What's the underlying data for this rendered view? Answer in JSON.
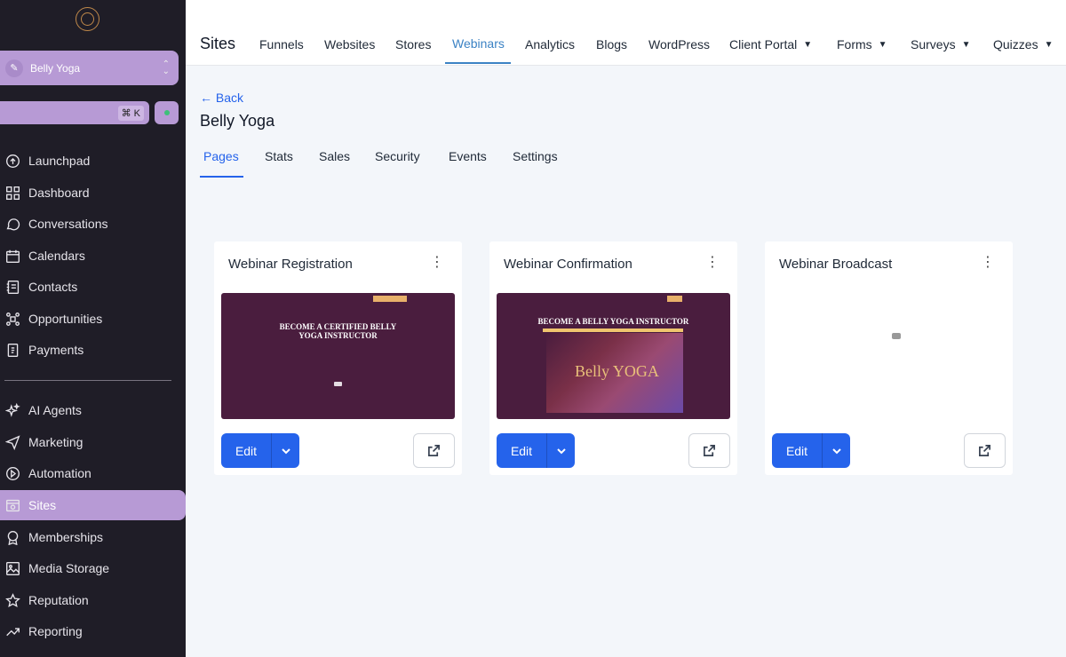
{
  "account": {
    "name": "Belly Yoga"
  },
  "search": {
    "shortcut": "⌘ K"
  },
  "sidebar": {
    "items": [
      {
        "label": "Launchpad",
        "icon": "launchpad-icon"
      },
      {
        "label": "Dashboard",
        "icon": "dashboard-icon"
      },
      {
        "label": "Conversations",
        "icon": "chat-icon"
      },
      {
        "label": "Calendars",
        "icon": "calendar-icon"
      },
      {
        "label": "Contacts",
        "icon": "contacts-icon"
      },
      {
        "label": "Opportunities",
        "icon": "opportunities-icon"
      },
      {
        "label": "Payments",
        "icon": "payments-icon"
      },
      {
        "label": "AI Agents",
        "icon": "sparkle-icon"
      },
      {
        "label": "Marketing",
        "icon": "send-icon"
      },
      {
        "label": "Automation",
        "icon": "automation-icon"
      },
      {
        "label": "Sites",
        "icon": "sites-icon"
      },
      {
        "label": "Memberships",
        "icon": "membership-icon"
      },
      {
        "label": "Media Storage",
        "icon": "image-icon"
      },
      {
        "label": "Reputation",
        "icon": "star-icon"
      },
      {
        "label": "Reporting",
        "icon": "trend-icon"
      }
    ],
    "active": "Sites"
  },
  "topbar": {
    "title": "Sites",
    "tabs": [
      {
        "label": "Funnels"
      },
      {
        "label": "Websites"
      },
      {
        "label": "Stores"
      },
      {
        "label": "Webinars"
      },
      {
        "label": "Analytics"
      },
      {
        "label": "Blogs"
      },
      {
        "label": "WordPress"
      },
      {
        "label": "Client Portal"
      },
      {
        "label": "Forms"
      },
      {
        "label": "Surveys"
      },
      {
        "label": "Quizzes"
      }
    ],
    "active": "Webinars"
  },
  "page": {
    "back": "← Back",
    "title": "Belly Yoga",
    "subtabs": [
      {
        "label": "Pages"
      },
      {
        "label": "Stats"
      },
      {
        "label": "Sales"
      },
      {
        "label": "Security"
      },
      {
        "label": "Events"
      },
      {
        "label": "Settings"
      }
    ],
    "active_subtab": "Pages"
  },
  "cards": [
    {
      "title": "Webinar Registration",
      "preview_headline_1": "BECOME A CERTIFIED BELLY",
      "preview_headline_2": "YOGA INSTRUCTOR",
      "edit_label": "Edit"
    },
    {
      "title": "Webinar Confirmation",
      "preview_headline_1": "BECOME A BELLY YOGA INSTRUCTOR",
      "preview_logo": "Belly YOGA",
      "edit_label": "Edit"
    },
    {
      "title": "Webinar Broadcast",
      "edit_label": "Edit"
    }
  ],
  "colors": {
    "sidebar_bg": "#1f1d27",
    "sidebar_accent": "#b79ad5",
    "primary": "#2563eb",
    "tab_active": "#3b82c4"
  }
}
